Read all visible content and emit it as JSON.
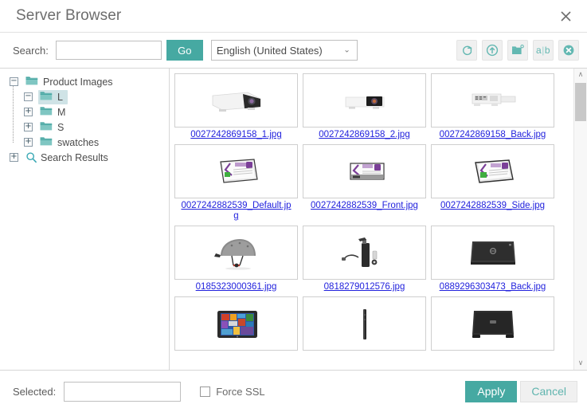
{
  "window": {
    "title": "Server Browser",
    "close_icon": "close-icon"
  },
  "toolbar": {
    "search_label": "Search:",
    "search_value": "",
    "search_placeholder": "",
    "go_label": "Go",
    "language_selected": "English (United States)",
    "language_options": [
      "English (United States)"
    ],
    "caret_glyph": "⌄",
    "buttons": [
      {
        "name": "refresh-button",
        "icon": "refresh-icon",
        "title": "Refresh"
      },
      {
        "name": "upload-button",
        "icon": "upload-circle-icon",
        "title": "Upload"
      },
      {
        "name": "new-folder-button",
        "icon": "new-folder-icon",
        "title": "New Folder"
      },
      {
        "name": "rename-button",
        "icon": "ab-rename-icon",
        "label_a": "a",
        "label_bar": "|",
        "label_b": "b",
        "title": "Rename"
      },
      {
        "name": "delete-button",
        "icon": "delete-circle-x-icon",
        "title": "Delete"
      }
    ]
  },
  "tree": {
    "root": {
      "label": "Product Images",
      "expander": "−",
      "selected": false
    },
    "children": [
      {
        "label": "L",
        "expander": "−",
        "selected": true
      },
      {
        "label": "M",
        "expander": "+",
        "selected": false
      },
      {
        "label": "S",
        "expander": "+",
        "selected": false
      },
      {
        "label": "swatches",
        "expander": "+",
        "selected": false
      }
    ],
    "search_results": {
      "label": "Search Results",
      "expander": "+",
      "icon": "search-icon",
      "selected": false
    }
  },
  "files": [
    {
      "name": "0027242869158_1.jpg",
      "thumb": "projector-angled"
    },
    {
      "name": "0027242869158_2.jpg",
      "thumb": "projector-front"
    },
    {
      "name": "0027242869158_Back.jpg",
      "thumb": "projector-back"
    },
    {
      "name": "0027242882539_Default.jpg",
      "thumb": "battery-default"
    },
    {
      "name": "0027242882539_Front.jpg",
      "thumb": "battery-front"
    },
    {
      "name": "0027242882539_Side.jpg",
      "thumb": "battery-side"
    },
    {
      "name": "0185323000361.jpg",
      "thumb": "helmet"
    },
    {
      "name": "0818279012576.jpg",
      "thumb": "bike-pump"
    },
    {
      "name": "0889296303473_Back.jpg",
      "thumb": "laptop-back"
    },
    {
      "name": "",
      "thumb": "windows-tablet"
    },
    {
      "name": "",
      "thumb": "device-side-edge"
    },
    {
      "name": "",
      "thumb": "laptop-lid"
    }
  ],
  "scrollbar": {
    "up_glyph": "∧",
    "down_glyph": "∨"
  },
  "footer": {
    "selected_label": "Selected:",
    "selected_value": "",
    "selected_placeholder": "",
    "force_ssl_label": "Force SSL",
    "force_ssl_checked": false,
    "apply_label": "Apply",
    "cancel_label": "Cancel"
  },
  "colors": {
    "accent_teal": "#46a9a2",
    "icon_teal": "#63b8b2",
    "link_blue": "#2222dd",
    "selection": "#cfe3e6",
    "title_gray": "#6d6d6d"
  }
}
